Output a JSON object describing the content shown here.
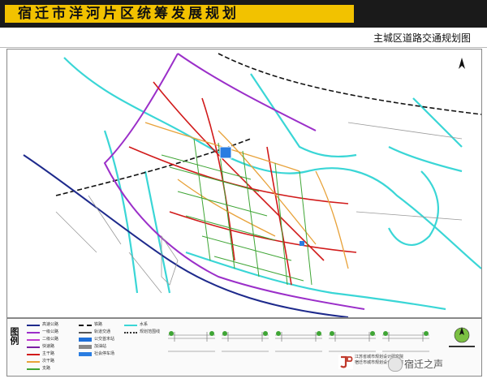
{
  "header": {
    "title": "宿迁市洋河片区统筹发展规划",
    "subtitle": "主城区道路交通规划图"
  },
  "colors": {
    "banner_bg": "#1a1a1a",
    "banner_accent": "#f2c200",
    "expressway": "#9b2fc9",
    "arterial_primary": "#d11a1a",
    "arterial_secondary": "#e8a23a",
    "arterial_green": "#3fa535",
    "river": "#3ad6d6",
    "railway": "#111111",
    "road_grey": "#9a9a9a"
  },
  "legend": {
    "title": "图例",
    "items": [
      {
        "label": "高速公路",
        "color": "#1e2a8c"
      },
      {
        "label": "一级公路",
        "color": "#9b2fc9"
      },
      {
        "label": "二级公路",
        "color": "#c23ad1"
      },
      {
        "label": "快速路",
        "color": "#7b1fa2"
      },
      {
        "label": "主干路",
        "color": "#d11a1a"
      },
      {
        "label": "次干路",
        "color": "#e8a23a"
      },
      {
        "label": "支路",
        "color": "#3fa535"
      },
      {
        "label": "铁路",
        "color": "#111111"
      },
      {
        "label": "轨道交通",
        "color": "#555555"
      },
      {
        "label": "公交首末站",
        "color": "#1e6fd9"
      },
      {
        "label": "加油站",
        "color": "#888888"
      },
      {
        "label": "社会停车场",
        "color": "#2a7de1"
      },
      {
        "label": "水系",
        "color": "#3ad6d6"
      },
      {
        "label": "规划范围线",
        "color": "#333333"
      }
    ]
  },
  "map_icons": [
    "north-arrow-icon",
    "station-icon"
  ],
  "footer": {
    "logo_text_1": "江苏省城市规划设计研究院",
    "logo_text_2": "宿迁市城市规划设计研究院",
    "watermark": "宿迁之声"
  }
}
